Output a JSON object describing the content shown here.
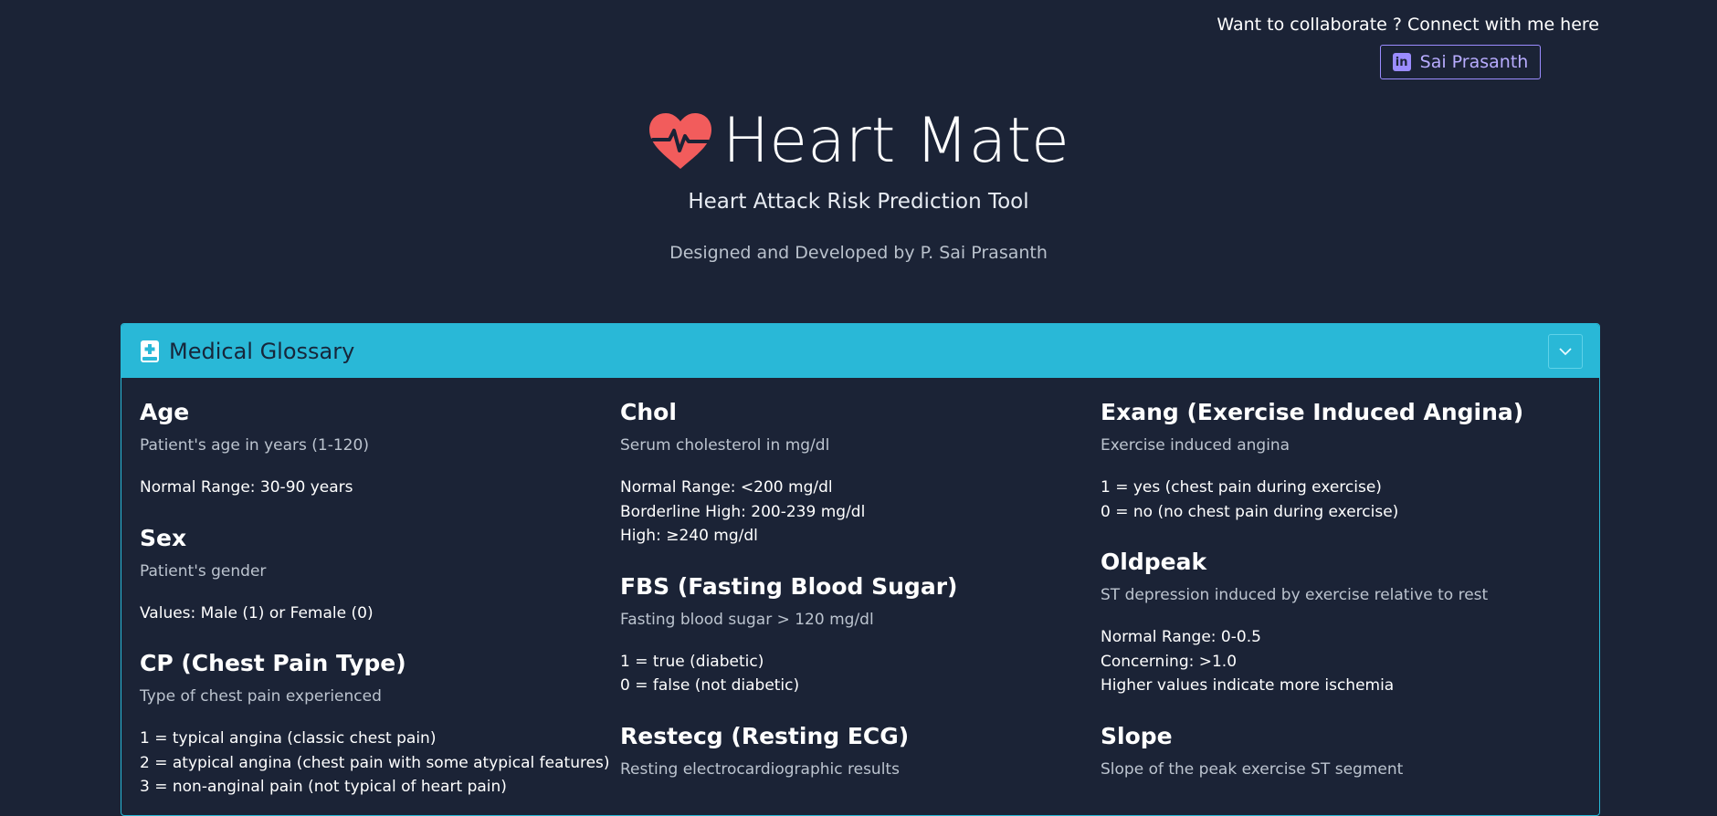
{
  "collab": {
    "text": "Want to collaborate ? Connect with me here",
    "linkedin_label": "Sai Prasanth",
    "linkedin_icon": "linkedin-icon"
  },
  "hero": {
    "title": "Heart Mate",
    "subtitle": "Heart Attack Risk Prediction Tool",
    "credit": "Designed and Developed by P. Sai Prasanth",
    "logo_icon": "heart-pulse-icon",
    "logo_color": "#f25c5c"
  },
  "glossary": {
    "title": "Medical Glossary",
    "header_icon": "medical-book-icon",
    "toggle_icon": "chevron-down-icon",
    "accent": "#29b8d7",
    "columns": [
      [
        {
          "term": "Age",
          "desc": "Patient's age in years (1-120)",
          "details": [
            "Normal Range: 30-90 years"
          ]
        },
        {
          "term": "Sex",
          "desc": "Patient's gender",
          "details": [
            "Values: Male (1) or Female (0)"
          ]
        },
        {
          "term": "CP (Chest Pain Type)",
          "desc": "Type of chest pain experienced",
          "details": [
            "1 = typical angina (classic chest pain)",
            "2 = atypical angina (chest pain with some atypical features)",
            "3 = non-anginal pain (not typical of heart pain)"
          ]
        }
      ],
      [
        {
          "term": "Chol",
          "desc": "Serum cholesterol in mg/dl",
          "details": [
            "Normal Range: <200 mg/dl",
            "Borderline High: 200-239 mg/dl",
            "High: ≥240 mg/dl"
          ]
        },
        {
          "term": "FBS (Fasting Blood Sugar)",
          "desc": "Fasting blood sugar > 120 mg/dl",
          "details": [
            "1 = true (diabetic)",
            "0 = false (not diabetic)"
          ]
        },
        {
          "term": "Restecg (Resting ECG)",
          "desc": "Resting electrocardiographic results",
          "details": []
        }
      ],
      [
        {
          "term": "Exang (Exercise Induced Angina)",
          "desc": "Exercise induced angina",
          "details": [
            "1 = yes (chest pain during exercise)",
            "0 = no (no chest pain during exercise)"
          ]
        },
        {
          "term": "Oldpeak",
          "desc": "ST depression induced by exercise relative to rest",
          "details": [
            "Normal Range: 0-0.5",
            "Concerning: >1.0",
            "Higher values indicate more ischemia"
          ]
        },
        {
          "term": "Slope",
          "desc": "Slope of the peak exercise ST segment",
          "details": []
        }
      ]
    ]
  }
}
